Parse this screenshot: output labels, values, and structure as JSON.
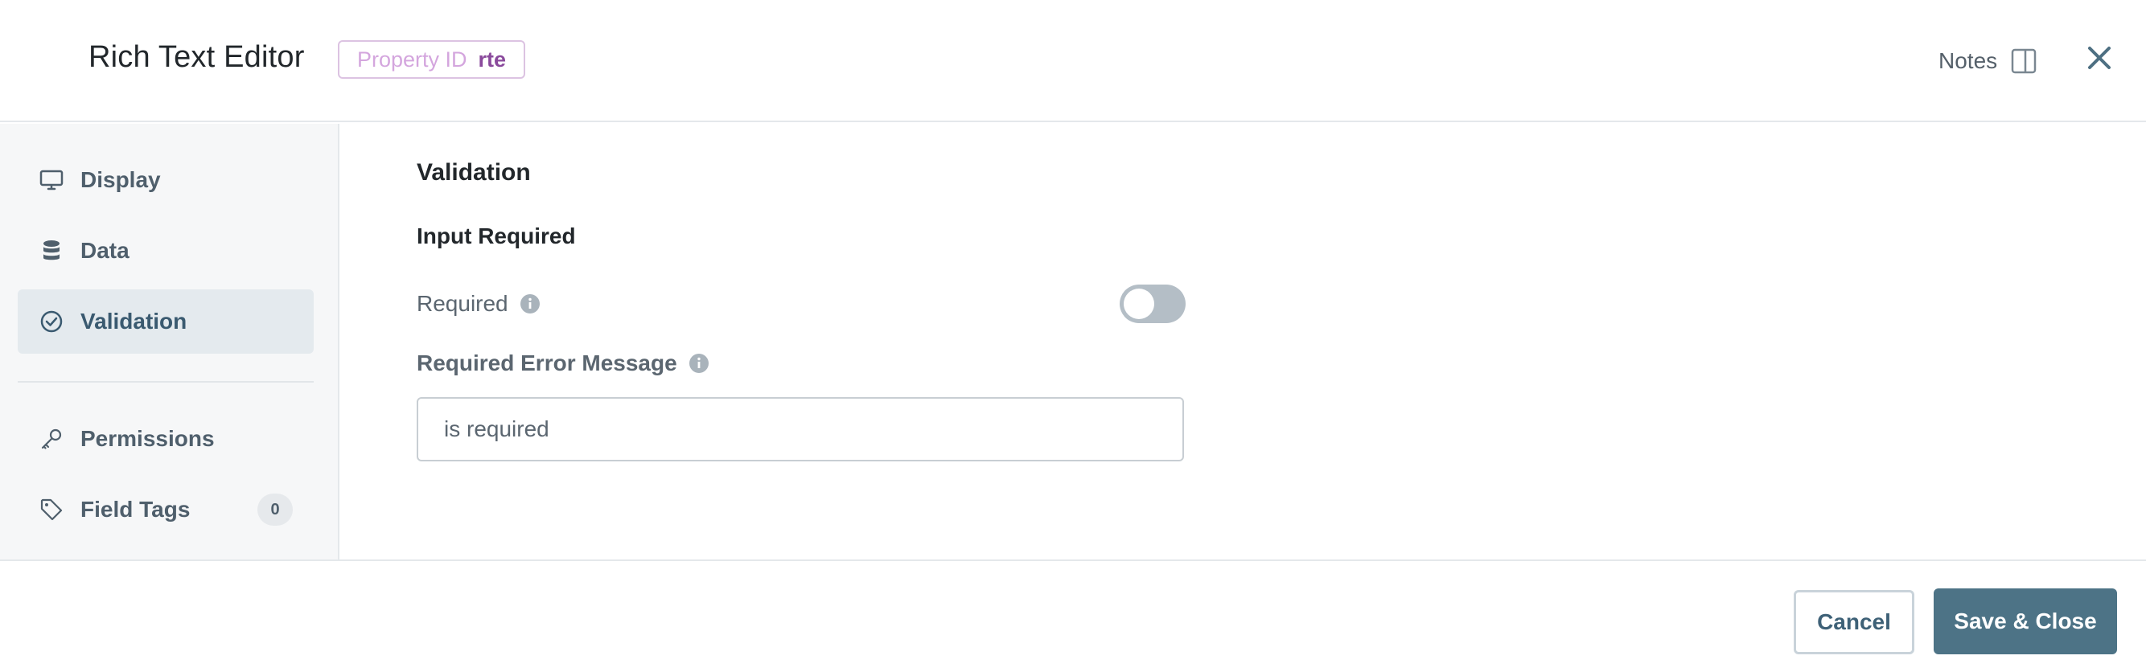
{
  "header": {
    "title": "Rich Text Editor",
    "property_id_label": "Property ID",
    "property_id_value": "rte",
    "notes_label": "Notes"
  },
  "sidebar": {
    "items": [
      {
        "label": "Display",
        "icon": "monitor-icon",
        "active": false
      },
      {
        "label": "Data",
        "icon": "database-icon",
        "active": false
      },
      {
        "label": "Validation",
        "icon": "check-circle-icon",
        "active": true
      },
      {
        "label": "Permissions",
        "icon": "key-icon",
        "active": false
      },
      {
        "label": "Field Tags",
        "icon": "tag-icon",
        "active": false,
        "badge": "0"
      }
    ]
  },
  "main": {
    "section_title": "Validation",
    "subsection_title": "Input Required",
    "required_label": "Required",
    "required_on": false,
    "error_message_label": "Required Error Message",
    "error_message_value": "is required"
  },
  "footer": {
    "cancel_label": "Cancel",
    "save_label": "Save & Close"
  },
  "colors": {
    "accent": "#4d7386",
    "property_id": "#8a4a9c",
    "sidebar_bg": "#f6f7f8",
    "active_item_bg": "#e4eaee"
  }
}
